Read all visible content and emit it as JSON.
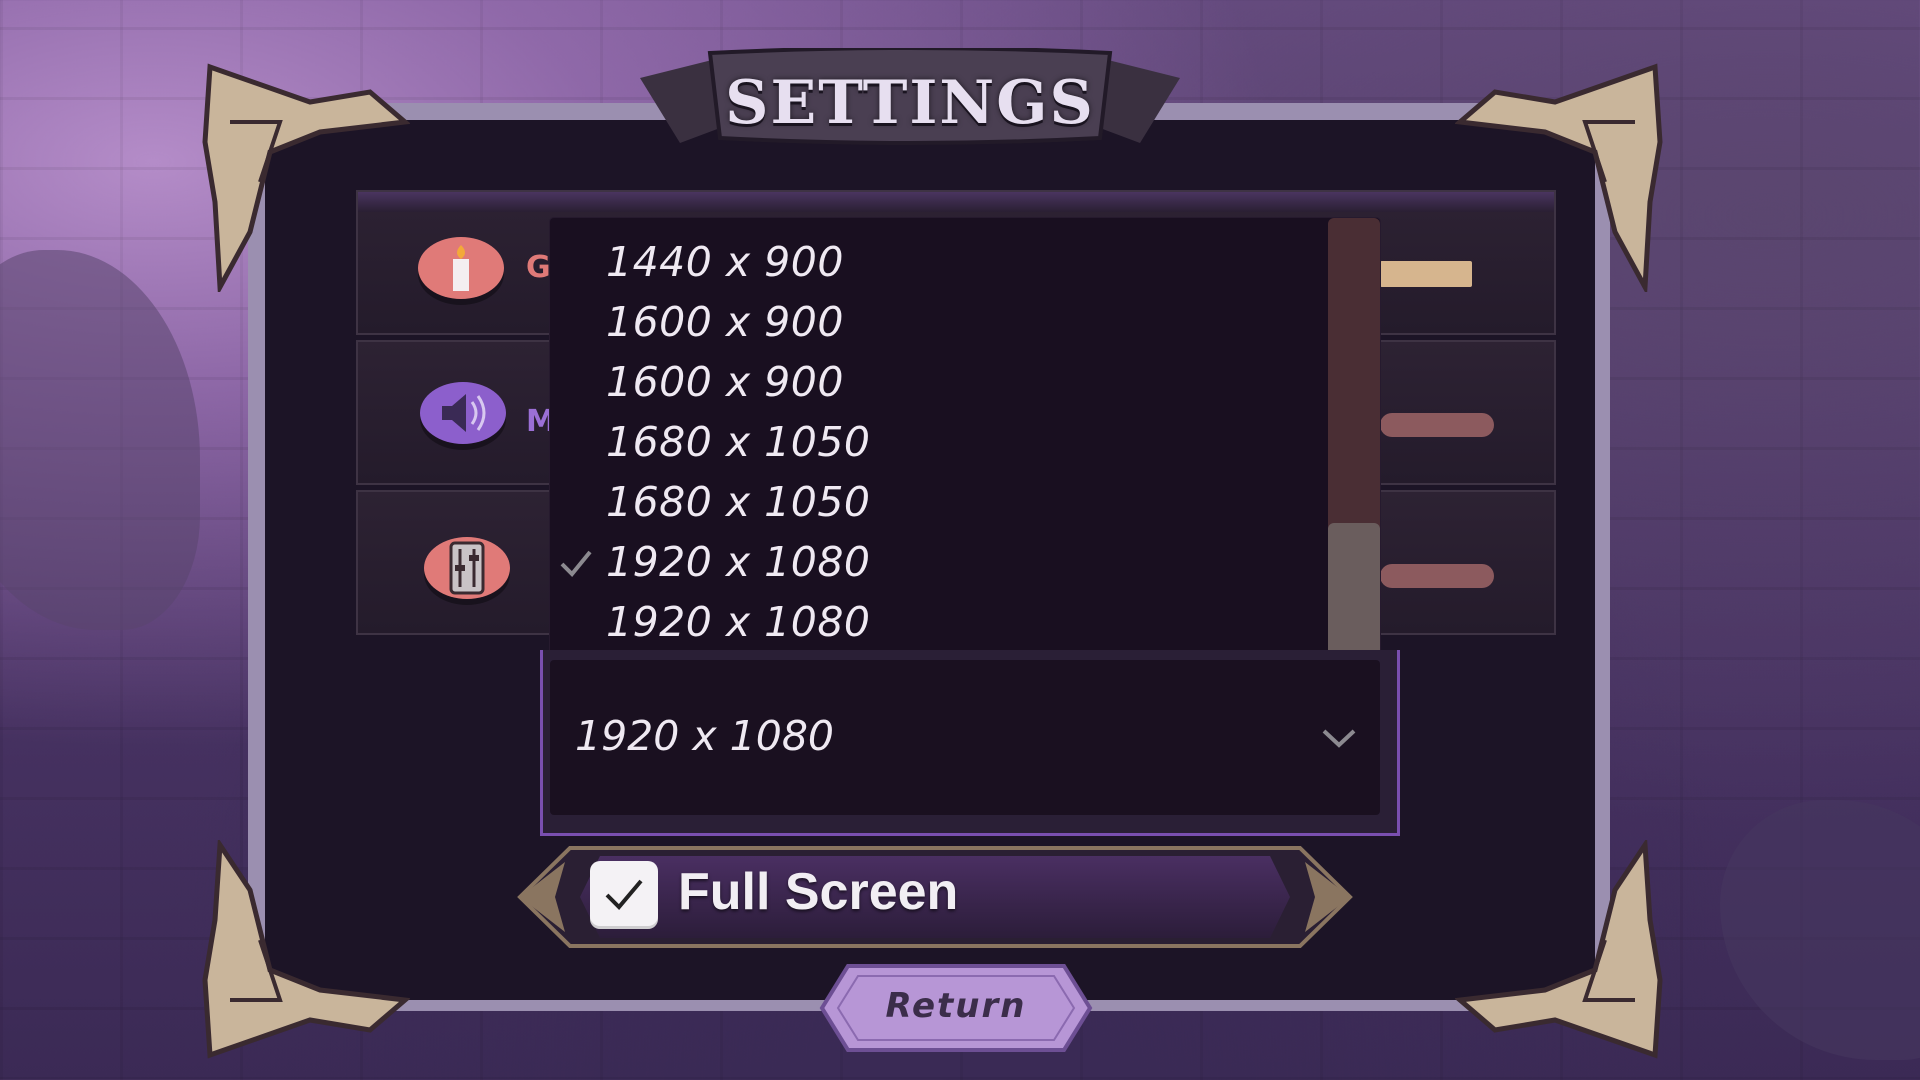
{
  "title": "SETTINGS",
  "rows": [
    {
      "id": "graphics",
      "label": "Gr",
      "icon": "candle-icon",
      "color": "#e08080"
    },
    {
      "id": "music",
      "label": "M",
      "icon": "speaker-icon",
      "color": "#9b6fd6"
    },
    {
      "id": "audio",
      "label": "",
      "icon": "mixer-icon",
      "color": "#e08080"
    }
  ],
  "sliders": [
    {
      "color": "#d6b58e",
      "level": 0.25
    },
    {
      "color": "#8c5a5e",
      "level": 0.3
    },
    {
      "color": "#8c5a5e",
      "level": 0.3
    }
  ],
  "resolution": {
    "options": [
      "1440 x 900",
      "1600 x 900",
      "1600 x 900",
      "1680 x 1050",
      "1680 x 1050",
      "1920 x 1080",
      "1920 x 1080"
    ],
    "checked_index": 5,
    "selected": "1920 x 1080"
  },
  "fullscreen": {
    "label": "Full Screen",
    "checked": true
  },
  "return_label": "Return"
}
